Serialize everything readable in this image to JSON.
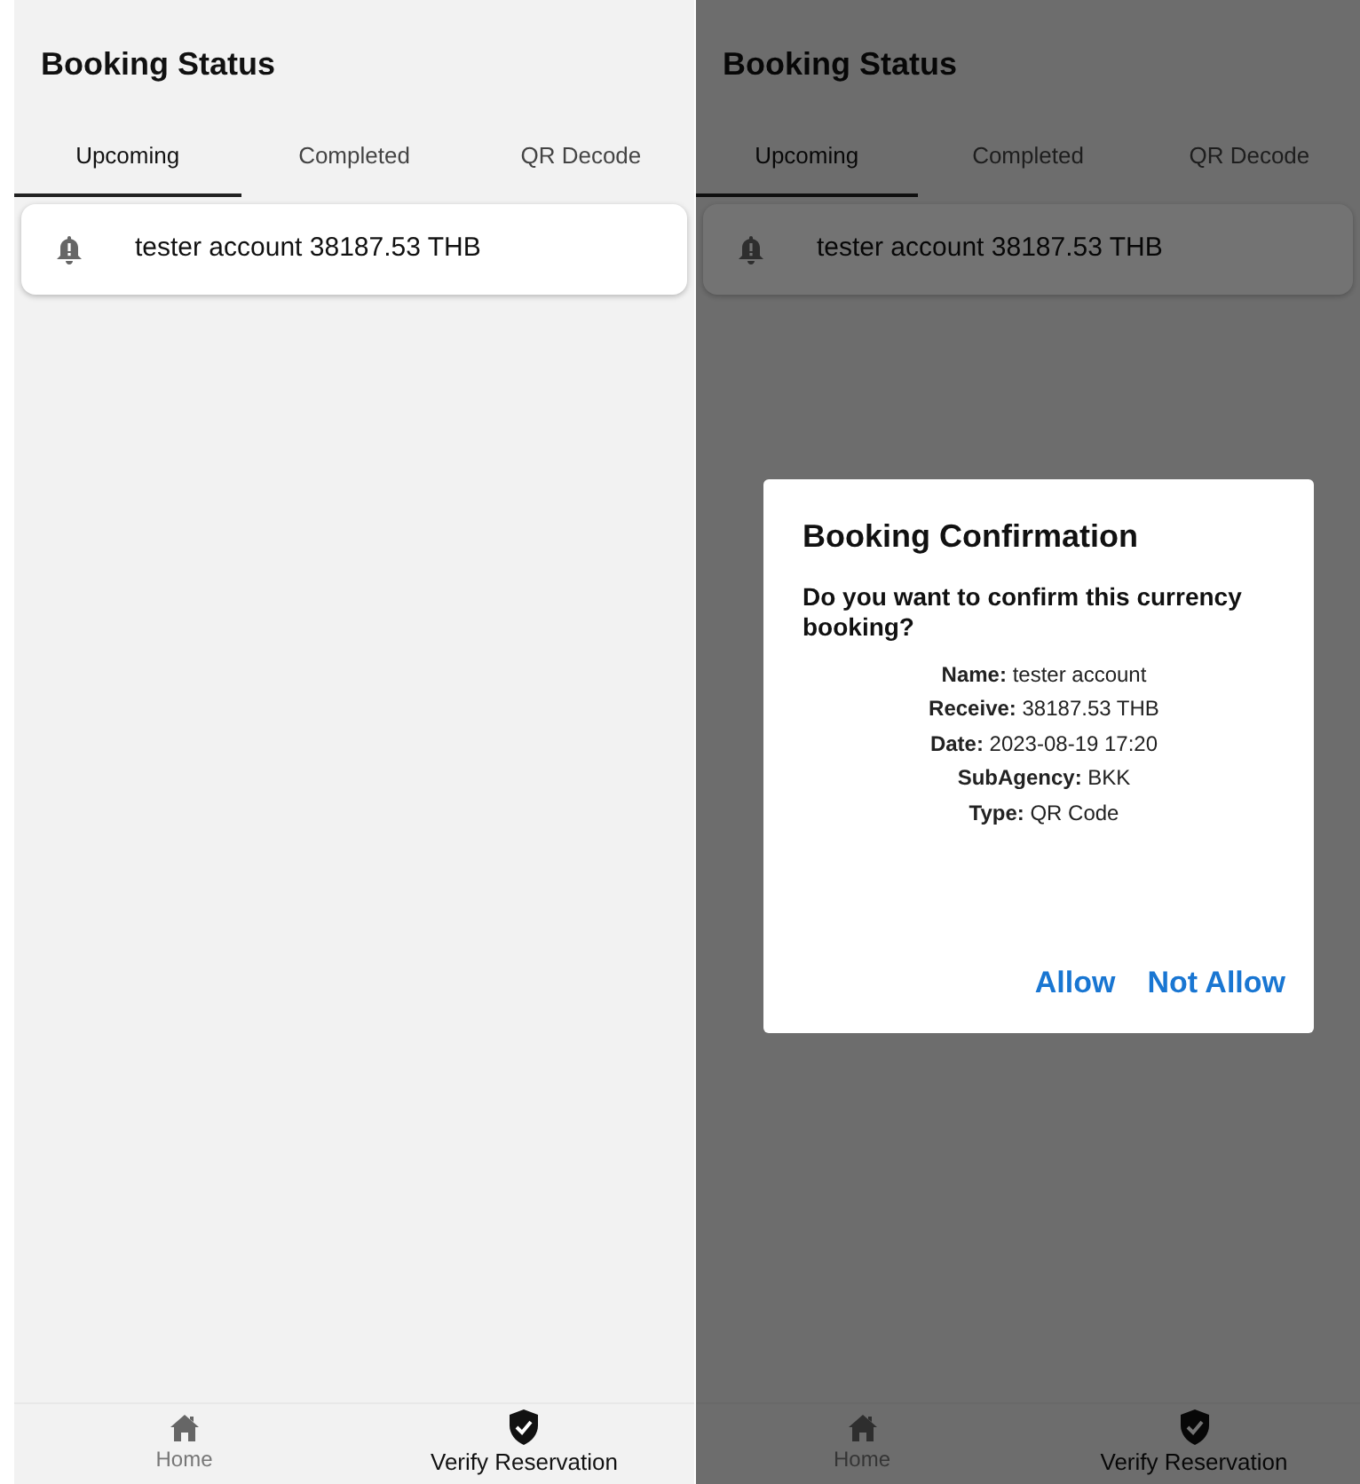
{
  "screens": [
    {
      "title": "Booking Status",
      "tabs": [
        {
          "label": "Upcoming",
          "selected": true
        },
        {
          "label": "Completed",
          "selected": false
        },
        {
          "label": "QR Decode",
          "selected": false
        }
      ],
      "bookings": [
        {
          "text": "tester account 38187.53 THB"
        }
      ],
      "nav": [
        {
          "label": "Home",
          "selected": false
        },
        {
          "label": "Verify Reservation",
          "selected": true
        }
      ]
    },
    {
      "title": "Booking Status",
      "tabs": [
        {
          "label": "Upcoming",
          "selected": true
        },
        {
          "label": "Completed",
          "selected": false
        },
        {
          "label": "QR Decode",
          "selected": false
        }
      ],
      "bookings": [
        {
          "text": "tester account 38187.53 THB"
        }
      ],
      "nav": [
        {
          "label": "Home",
          "selected": false
        },
        {
          "label": "Verify Reservation",
          "selected": true
        }
      ],
      "dialog": {
        "title": "Booking Confirmation",
        "question": "Do you want to confirm this currency booking?",
        "details": [
          "**Name:** tester account",
          "**Receive:** 38187.53 THB",
          "**Date:** 2023-08-19 17:20",
          "**SubAgency:** BKK",
          "**Type:** QR Code"
        ],
        "actions": [
          "Allow",
          "Not Allow"
        ]
      }
    }
  ]
}
